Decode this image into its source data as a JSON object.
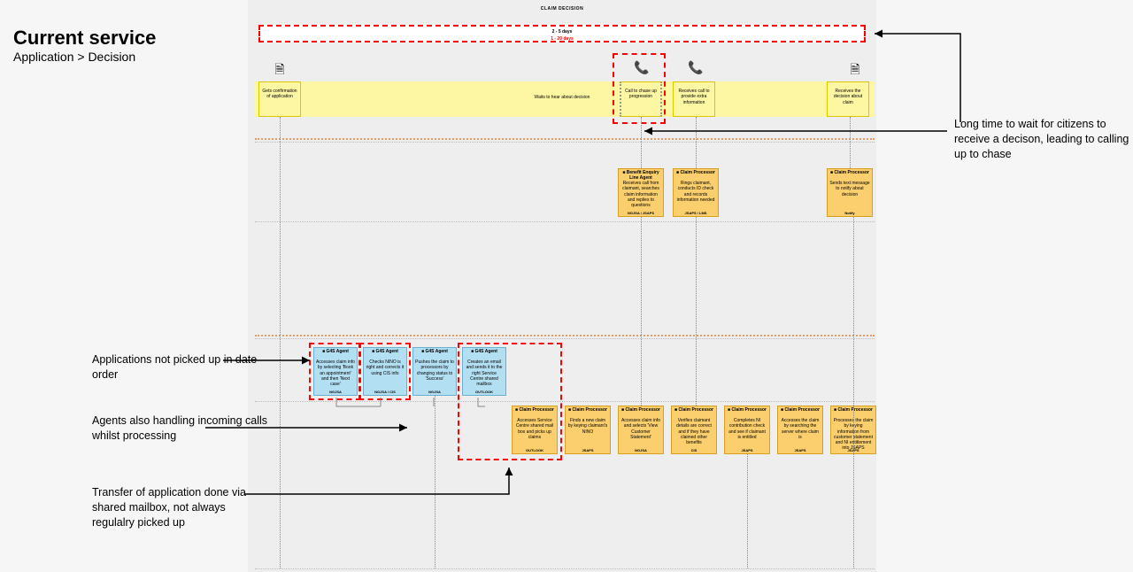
{
  "title": "Current service",
  "breadcrumb": "Application > Decision",
  "phase": "CLAIM DECISION",
  "timeline": {
    "normal": "2 - 5 days",
    "worst": "1 - 20 days"
  },
  "citizen": {
    "c1": "Gets confirmation of application",
    "c2": "Waits to hear about decision",
    "c3": "Call to chase up progression",
    "c4": "Receives call to provide extra information",
    "c5": "Receives the decision about claim"
  },
  "roles": {
    "bel": "Benefit Enquiry Line Agent",
    "cp": "Claim Processor",
    "g4s": "G4S Agent"
  },
  "actors": {
    "a1": "Receives call from claimant, searches claim information and replies to questions",
    "a1f": "NGJSA / JSAPS",
    "a2": "Rings claimant, conducts ID check and records information needed",
    "a2f": "JSAPS / LMS",
    "a3": "Sends text message to notify about decision",
    "a3f": "Notify",
    "g1": "Accesses claim info by selecting 'Book an appointment' and then 'Next case'",
    "g1f": "NGJSA",
    "g2": "Checks NINO is right and corrects it using CIS info",
    "g2f": "NGJSA / CIS",
    "g3": "Pushes the claim to processors by changing status to 'Success'",
    "g3f": "NGJSA",
    "g4": "Creates an email and sends it to the right Service Centre shared mailbox",
    "g4f": "OUTLOOK",
    "p1": "Accesses Service Centre shared mail box and picks up claims",
    "p1f": "OUTLOOK",
    "p2": "Finds a new claim by keying claimant's NINO",
    "p2f": "JSAPS",
    "p3": "Accesses claim info and selects 'View Customer Statement'",
    "p3f": "NGJSA",
    "p4": "Verifies claimant details are correct and if they have claimed other benefits",
    "p4f": "CIS",
    "p5": "Completes NI contribution check and see if claimant is entitled",
    "p5f": "JSAPS",
    "p6": "Accesses the claim by searching the server where claim is",
    "p6f": "JSAPS",
    "p7": "Processes the claim by keying information from customer statement and NI entitlement into JSAPS",
    "p7f": "JSAPS"
  },
  "anno": {
    "a1": "Long time to wait for citizens to receive a decison, leading to calling up to chase",
    "a2": "Applications not picked up in date order",
    "a3": "Agents also handling incoming calls whilst processing",
    "a4": "Transfer of application done via shared mailbox, not always regulalry picked up"
  }
}
